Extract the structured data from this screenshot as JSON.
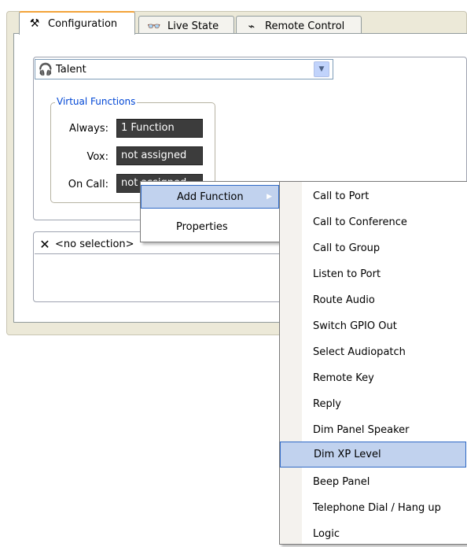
{
  "tabs": [
    {
      "label": "Configuration",
      "icon": "tools-icon"
    },
    {
      "label": "Live State",
      "icon": "glasses-icon"
    },
    {
      "label": "Remote Control",
      "icon": "remote-icon"
    }
  ],
  "talent": {
    "label": "Talent",
    "icon": "headset-icon"
  },
  "virtual_functions": {
    "title": "Virtual Functions",
    "rows": [
      {
        "label": "Always:",
        "value": "1 Function"
      },
      {
        "label": "Vox:",
        "value": "not assigned"
      },
      {
        "label": "On Call:",
        "value": "not assigned"
      }
    ]
  },
  "selection": {
    "label": "<no selection>"
  },
  "context_menu": {
    "items": [
      {
        "label": "Add Function",
        "highlighted": true
      },
      {
        "label": "Properties",
        "highlighted": false
      }
    ]
  },
  "submenu": {
    "items": [
      {
        "label": "Call to Port"
      },
      {
        "label": "Call to Conference"
      },
      {
        "label": "Call to Group"
      },
      {
        "label": "Listen to Port"
      },
      {
        "label": "Route Audio"
      },
      {
        "label": "Switch GPIO Out"
      },
      {
        "label": "Select Audiopatch"
      },
      {
        "label": "Remote Key"
      },
      {
        "label": "Reply"
      },
      {
        "label": "Dim Panel Speaker"
      },
      {
        "label": "Dim XP Level",
        "highlighted": true
      },
      {
        "label": "Beep Panel"
      },
      {
        "label": "Telephone Dial / Hang up"
      },
      {
        "label": "Logic"
      }
    ]
  },
  "colors": {
    "highlight": "#c1d2ee",
    "highlight_border": "#316ac5",
    "active_tab_accent": "#f3a33a",
    "group_title": "#0046d5"
  }
}
